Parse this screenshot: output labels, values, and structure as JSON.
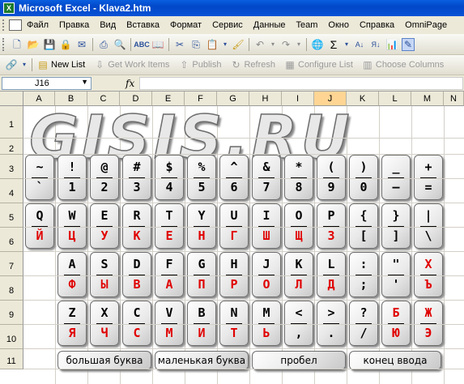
{
  "window": {
    "title": "Microsoft Excel - Klava2.htm"
  },
  "menu": [
    "Файл",
    "Правка",
    "Вид",
    "Вставка",
    "Формат",
    "Сервис",
    "Данные",
    "Team",
    "Окно",
    "Справка",
    "OmniPage"
  ],
  "toolbar2": {
    "new_list": "New List",
    "get_work_items": "Get Work Items",
    "publish": "Publish",
    "refresh": "Refresh",
    "configure_list": "Configure List",
    "choose_columns": "Choose Columns"
  },
  "formula_bar": {
    "name_box": "J16",
    "fx": "fx",
    "value": ""
  },
  "sheet": {
    "columns": [
      "A",
      "B",
      "C",
      "D",
      "E",
      "F",
      "G",
      "H",
      "I",
      "J",
      "K",
      "L",
      "M",
      "N"
    ],
    "active_column": "J",
    "rows": [
      "1",
      "2",
      "3",
      "4",
      "5",
      "6",
      "7",
      "8",
      "9",
      "10",
      "11"
    ],
    "logo_text": "GISIS.RU"
  },
  "keyboard": {
    "row1": [
      {
        "top": "~",
        "bot": "`"
      },
      {
        "top": "!",
        "bot": "1"
      },
      {
        "top": "@",
        "bot": "2"
      },
      {
        "top": "#",
        "bot": "3"
      },
      {
        "top": "$",
        "bot": "4"
      },
      {
        "top": "%",
        "bot": "5"
      },
      {
        "top": "^",
        "bot": "6"
      },
      {
        "top": "&",
        "bot": "7"
      },
      {
        "top": "*",
        "bot": "8"
      },
      {
        "top": "(",
        "bot": "9"
      },
      {
        "top": ")",
        "bot": "0"
      },
      {
        "top": "_",
        "bot": "–"
      },
      {
        "top": "+",
        "bot": "="
      }
    ],
    "row2": [
      {
        "top": "Q",
        "bot": "Й"
      },
      {
        "top": "W",
        "bot": "Ц"
      },
      {
        "top": "E",
        "bot": "У"
      },
      {
        "top": "R",
        "bot": "К"
      },
      {
        "top": "T",
        "bot": "Е"
      },
      {
        "top": "Y",
        "bot": "Н"
      },
      {
        "top": "U",
        "bot": "Г"
      },
      {
        "top": "I",
        "bot": "Ш"
      },
      {
        "top": "O",
        "bot": "Щ"
      },
      {
        "top": "P",
        "bot": "З"
      },
      {
        "top": "{",
        "bot": "[",
        "ascii": true
      },
      {
        "top": "}",
        "bot": "]",
        "ascii": true
      },
      {
        "top": "|",
        "bot": "\\",
        "ascii": true
      }
    ],
    "row3": [
      {
        "top": "A",
        "bot": "Ф"
      },
      {
        "top": "S",
        "bot": "Ы"
      },
      {
        "top": "D",
        "bot": "В"
      },
      {
        "top": "F",
        "bot": "А"
      },
      {
        "top": "G",
        "bot": "П"
      },
      {
        "top": "H",
        "bot": "Р"
      },
      {
        "top": "J",
        "bot": "О"
      },
      {
        "top": "K",
        "bot": "Л"
      },
      {
        "top": "L",
        "bot": "Д"
      },
      {
        "top": ":",
        "bot": ";",
        "ascii": true
      },
      {
        "top": "\"",
        "bot": "'",
        "ascii": true
      },
      {
        "top": "Х",
        "bot": "Ъ",
        "both_ru": true
      }
    ],
    "row4": [
      {
        "top": "Z",
        "bot": "Я"
      },
      {
        "top": "X",
        "bot": "Ч"
      },
      {
        "top": "C",
        "bot": "С"
      },
      {
        "top": "V",
        "bot": "М"
      },
      {
        "top": "B",
        "bot": "И"
      },
      {
        "top": "N",
        "bot": "Т"
      },
      {
        "top": "M",
        "bot": "Ь"
      },
      {
        "top": "<",
        "bot": ",",
        "ascii": true
      },
      {
        "top": ">",
        "bot": ".",
        "ascii": true
      },
      {
        "top": "?",
        "bot": "/",
        "ascii": true
      },
      {
        "top": "Б",
        "bot": "Ю",
        "both_ru": true
      },
      {
        "top": "Ж",
        "bot": "Э",
        "both_ru": true
      }
    ],
    "buttons": {
      "uppercase": "большая буква",
      "lowercase": "маленькая буква",
      "space": "пробел",
      "end_input": "конец ввода"
    }
  }
}
